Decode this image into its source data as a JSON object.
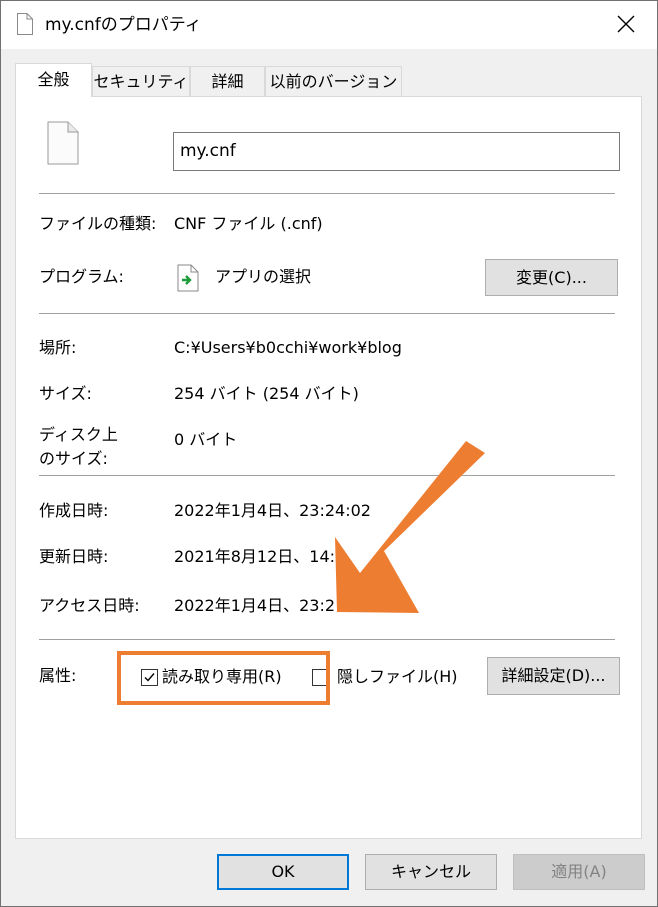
{
  "window": {
    "title": "my.cnfのプロパティ"
  },
  "tabs": [
    {
      "label": "全般",
      "active": true
    },
    {
      "label": "セキュリティ",
      "active": false
    },
    {
      "label": "詳細",
      "active": false
    },
    {
      "label": "以前のバージョン",
      "active": false
    }
  ],
  "general": {
    "file_name": "my.cnf",
    "file_type_label": "ファイルの種類:",
    "file_type_value": "CNF ファイル (.cnf)",
    "program_label": "プログラム:",
    "program_value": "アプリの選択",
    "change_button": "変更(C)...",
    "location_label": "場所:",
    "location_value": "C:¥Users¥b0cchi¥work¥blog",
    "size_label": "サイズ:",
    "size_value": "254 バイト (254 バイト)",
    "disk_size_label_1": "ディスク上",
    "disk_size_label_2": "のサイズ:",
    "disk_size_value": "0 バイト",
    "created_label": "作成日時:",
    "created_value": "2022年1月4日、23:24:02",
    "modified_label": "更新日時:",
    "modified_value": "2021年8月12日、14:",
    "accessed_label": "アクセス日時:",
    "accessed_value": "2022年1月4日、23:2",
    "attributes_label": "属性:",
    "readonly_label": "読み取り専用(R)",
    "readonly_checked": true,
    "hidden_label": "隠しファイル(H)",
    "hidden_checked": false,
    "advanced_button": "詳細設定(D)..."
  },
  "footer": {
    "ok_button": "OK",
    "cancel_button": "キャンセル",
    "apply_button": "適用(A)"
  },
  "colors": {
    "annotation": "#ed7d31",
    "default_button_border": "#0078d7"
  }
}
